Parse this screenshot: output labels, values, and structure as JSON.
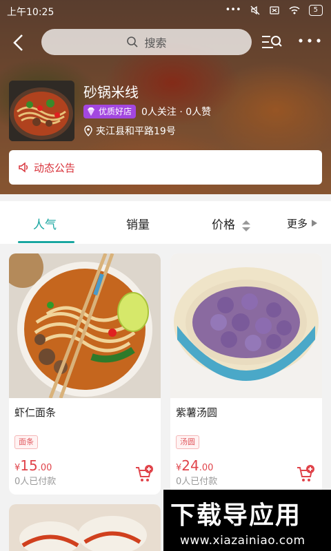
{
  "status_bar": {
    "time": "上午10:25",
    "icons": [
      "signal-dots-icon",
      "mute-icon",
      "sim-icon",
      "wifi-icon",
      "battery-icon"
    ],
    "battery": "5"
  },
  "top_bar": {
    "search_placeholder": "搜索"
  },
  "store": {
    "name": "砂锅米线",
    "badge": "优质好店",
    "follow_stats": "0人关注 · 0人赞",
    "address": "夹江县和平路19号",
    "notice": "动态公告"
  },
  "tabs": [
    {
      "label": "人气",
      "active": true
    },
    {
      "label": "销量",
      "active": false
    },
    {
      "label": "价格",
      "active": false
    },
    {
      "label": "更多",
      "active": false
    }
  ],
  "products": [
    {
      "name": "虾仁面条",
      "tag": "面条",
      "currency": "¥",
      "price_int": "15",
      "price_dec": ".00",
      "paid": "0人已付款"
    },
    {
      "name": "紫薯汤圆",
      "tag": "汤圆",
      "currency": "¥",
      "price_int": "24",
      "price_dec": ".00",
      "paid": "0人已付款"
    }
  ],
  "watermark": {
    "title": "下载导应用",
    "url": "www.xiazainiao.com"
  },
  "colors": {
    "accent": "#19a6a0",
    "price": "#e0434a",
    "badge": "#a347e0",
    "notice": "#d8323a"
  }
}
